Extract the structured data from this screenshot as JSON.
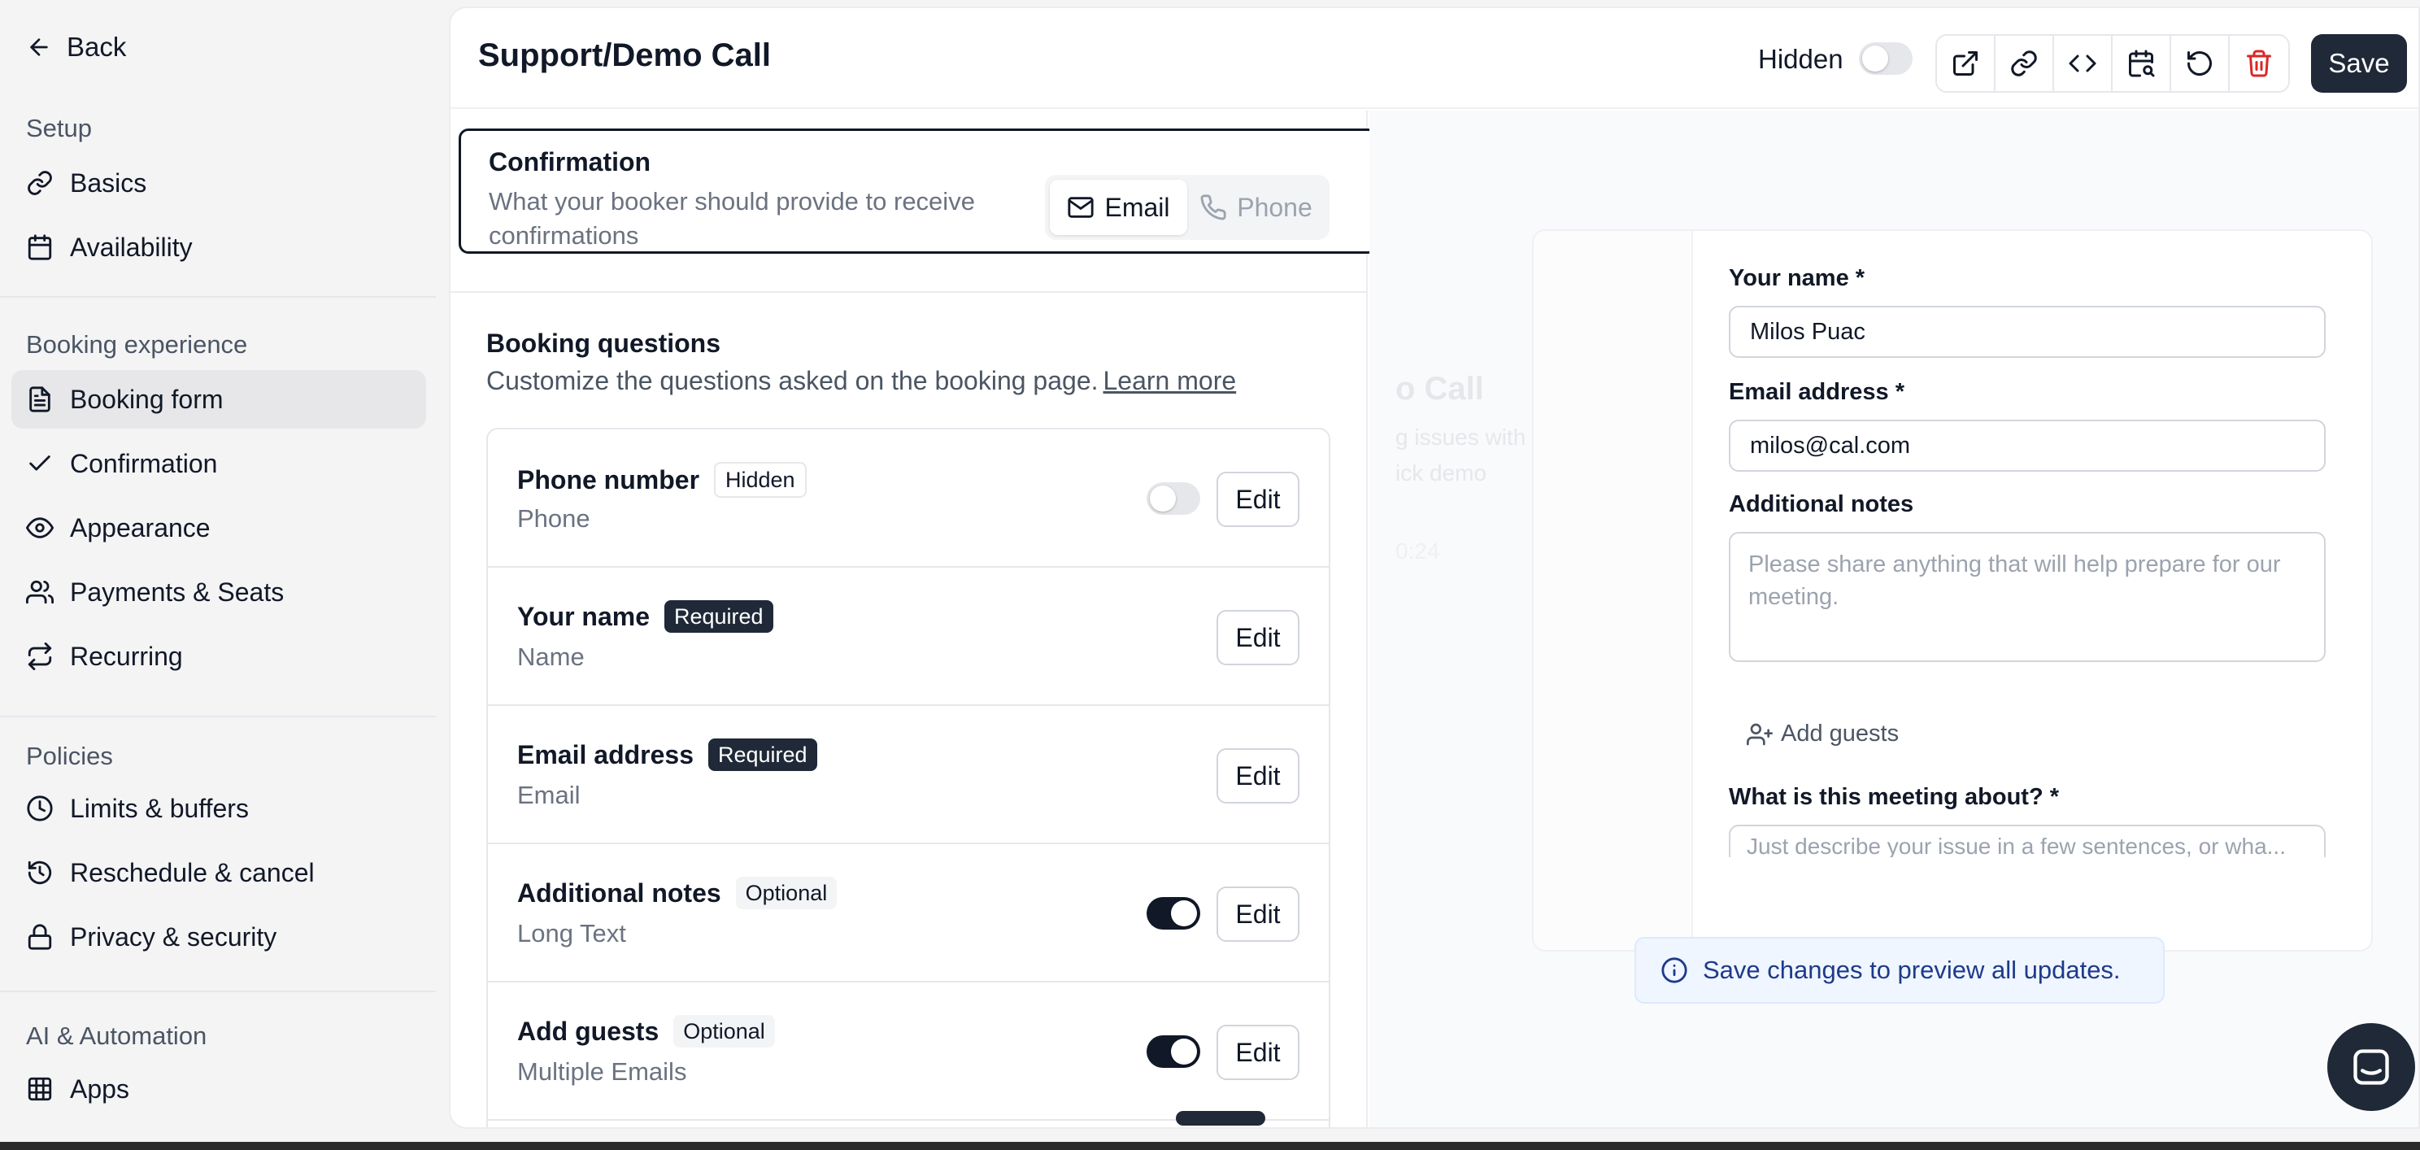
{
  "sidebar": {
    "back_label": "Back",
    "sections": [
      {
        "title": "Setup",
        "items": [
          {
            "label": "Basics",
            "icon": "link-icon"
          },
          {
            "label": "Availability",
            "icon": "calendar-icon"
          }
        ]
      },
      {
        "title": "Booking experience",
        "items": [
          {
            "label": "Booking form",
            "icon": "file-text-icon",
            "active": true
          },
          {
            "label": "Confirmation",
            "icon": "check-icon"
          },
          {
            "label": "Appearance",
            "icon": "eye-icon"
          },
          {
            "label": "Payments & Seats",
            "icon": "users-icon"
          },
          {
            "label": "Recurring",
            "icon": "repeat-icon"
          }
        ]
      },
      {
        "title": "Policies",
        "items": [
          {
            "label": "Limits & buffers",
            "icon": "clock-icon"
          },
          {
            "label": "Reschedule & cancel",
            "icon": "history-icon"
          },
          {
            "label": "Privacy & security",
            "icon": "lock-icon"
          }
        ]
      },
      {
        "title": "AI & Automation",
        "items": [
          {
            "label": "Apps",
            "icon": "grid-icon"
          }
        ]
      }
    ]
  },
  "header": {
    "title": "Support/Demo Call",
    "hidden_label": "Hidden",
    "hidden_toggle_on": false,
    "toolbar_icons": [
      "external-link-icon",
      "link-icon",
      "code-icon",
      "calendar-search-icon",
      "rotate-ccw-icon",
      "trash-icon"
    ],
    "save_label": "Save"
  },
  "confirmation": {
    "title": "Confirmation",
    "description": "What your booker should provide to receive confirmations",
    "options": [
      {
        "label": "Email",
        "icon": "mail-icon",
        "selected": true
      },
      {
        "label": "Phone",
        "icon": "phone-icon",
        "selected": false
      }
    ]
  },
  "booking_questions": {
    "title": "Booking questions",
    "description": "Customize the questions asked on the booking page.",
    "learn_more": "Learn more",
    "edit_label": "Edit",
    "questions": [
      {
        "name": "Phone number",
        "badge": "Hidden",
        "badge_style": "light",
        "type": "Phone",
        "has_toggle": true,
        "toggle_on": false
      },
      {
        "name": "Your name",
        "badge": "Required",
        "badge_style": "dark",
        "type": "Name",
        "has_toggle": false
      },
      {
        "name": "Email address",
        "badge": "Required",
        "badge_style": "dark",
        "type": "Email",
        "has_toggle": false
      },
      {
        "name": "Additional notes",
        "badge": "Optional",
        "badge_style": "gray",
        "type": "Long Text",
        "has_toggle": true,
        "toggle_on": true
      },
      {
        "name": "Add guests",
        "badge": "Optional",
        "badge_style": "gray",
        "type": "Multiple Emails",
        "has_toggle": true,
        "toggle_on": true
      }
    ]
  },
  "preview": {
    "ghost_title": "o Call",
    "ghost_line1": "g issues with",
    "ghost_line2": "ick demo",
    "ghost_line3": "0:24",
    "name_label": "Your name *",
    "name_value": "Milos Puac",
    "email_label": "Email address *",
    "email_value": "milos@cal.com",
    "notes_label": "Additional notes",
    "notes_placeholder": "Please share anything that will help prepare for our meeting.",
    "add_guests_label": "Add guests",
    "meeting_label": "What is this meeting about? *",
    "meeting_placeholder": "Just describe your issue in a few sentences, or wha...",
    "notice": "Save changes to preview all updates."
  },
  "colors": {
    "accent": "#111827",
    "notice_bg": "#eff6ff",
    "notice_text": "#1e3a8a",
    "danger": "#dc2626"
  }
}
